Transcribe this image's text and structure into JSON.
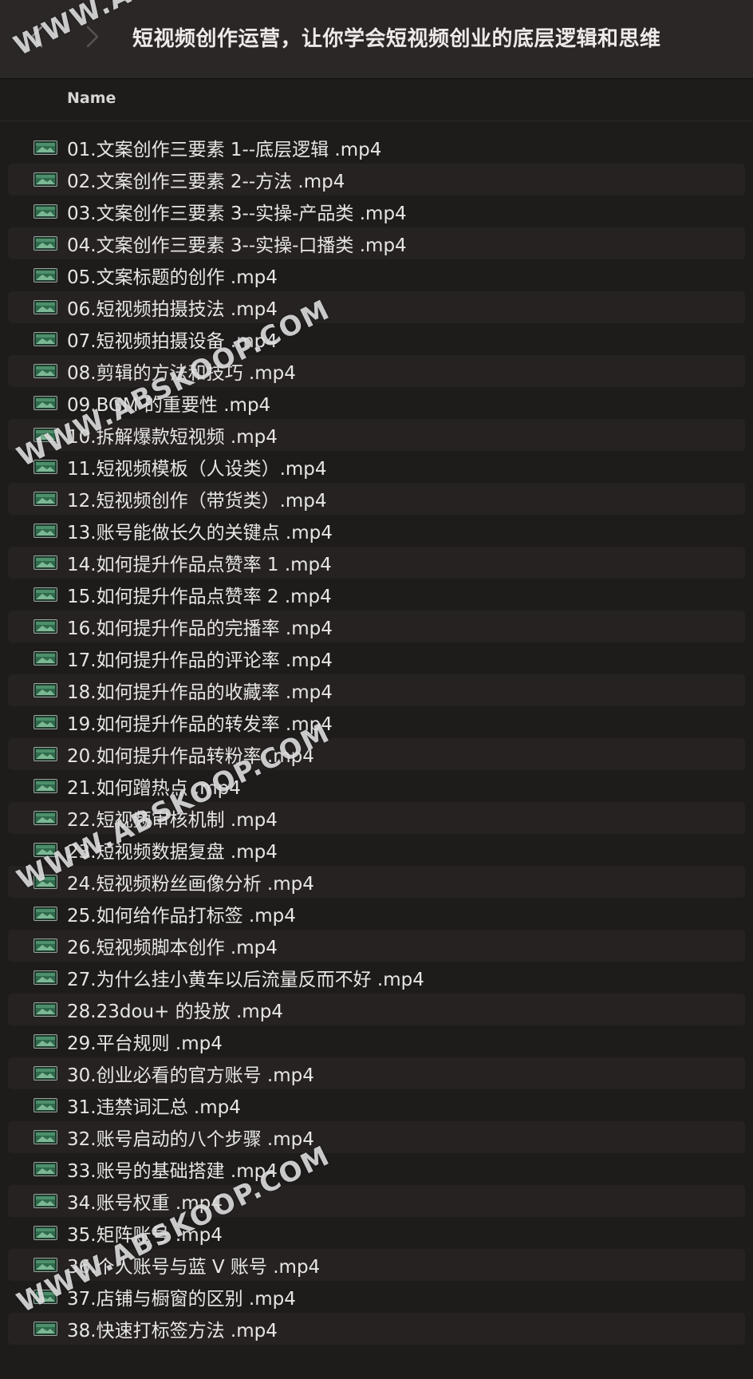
{
  "window": {
    "title": "短视频创作运营，让你学会短视频创业的底层逻辑和思维",
    "back_icon": "chevron-left-icon",
    "forward_icon": "chevron-right-icon"
  },
  "columns": {
    "name": "Name"
  },
  "watermark": "WWW.ABSKOOP.COM",
  "file_icon": "video-file-icon",
  "files": [
    "01.文案创作三要素 1--底层逻辑 .mp4",
    "02.文案创作三要素 2--方法 .mp4",
    "03.文案创作三要素 3--实操-产品类 .mp4",
    "04.文案创作三要素 3--实操-口播类 .mp4",
    "05.文案标题的创作 .mp4",
    "06.短视频拍摄技法 .mp4",
    "07.短视频拍摄设备 .mp4",
    "08.剪辑的方法和技巧 .mp4",
    "09.BGM 的重要性 .mp4",
    "10.拆解爆款短视频 .mp4",
    "11.短视频模板（人设类）.mp4",
    "12.短视频创作（带货类）.mp4",
    "13.账号能做长久的关键点 .mp4",
    "14.如何提升作品点赞率 1 .mp4",
    "15.如何提升作品点赞率 2 .mp4",
    "16.如何提升作品的完播率 .mp4",
    "17.如何提升作品的评论率 .mp4",
    "18.如何提升作品的收藏率 .mp4",
    "19.如何提升作品的转发率 .mp4",
    "20.如何提升作品转粉率 .mp4",
    "21.如何蹭热点 .mp4",
    "22.短视频审核机制 .mp4",
    "23.短视频数据复盘 .mp4",
    "24.短视频粉丝画像分析 .mp4",
    "25.如何给作品打标签 .mp4",
    "26.短视频脚本创作 .mp4",
    "27.为什么挂小黄车以后流量反而不好 .mp4",
    "28.23dou+ 的投放 .mp4",
    "29.平台规则 .mp4",
    "30.创业必看的官方账号 .mp4",
    "31.违禁词汇总 .mp4",
    "32.账号启动的八个步骤 .mp4",
    "33.账号的基础搭建 .mp4",
    "34.账号权重 .mp4",
    "35.矩阵账号 .mp4",
    "36.个人账号与蓝 V 账号 .mp4",
    "37.店铺与橱窗的区别 .mp4",
    "38.快速打标签方法 .mp4"
  ]
}
